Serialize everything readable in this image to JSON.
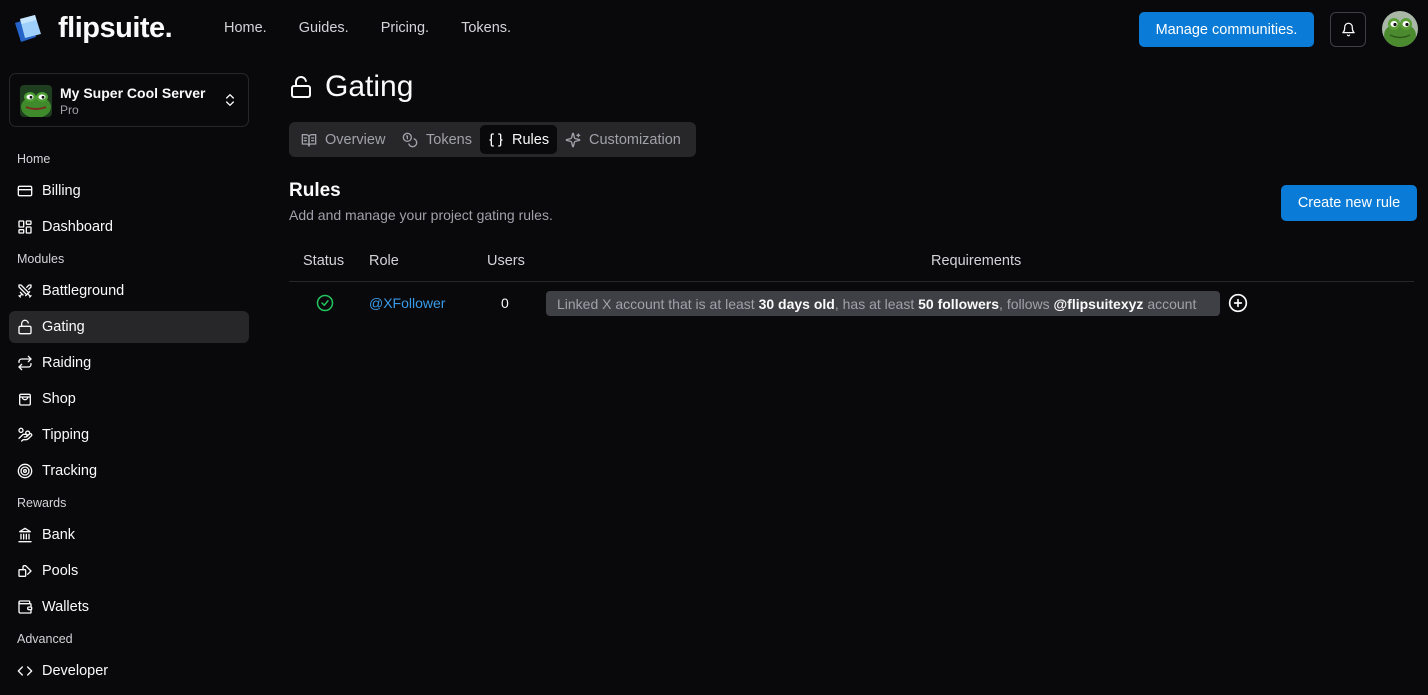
{
  "brand": {
    "name": "flipsuite."
  },
  "topnav": {
    "links": [
      "Home.",
      "Guides.",
      "Pricing.",
      "Tokens."
    ],
    "manage_label": "Manage communities."
  },
  "server": {
    "name": "My Super Cool Server",
    "plan": "Pro"
  },
  "sidebar": {
    "sections": {
      "home": "Home",
      "modules": "Modules",
      "rewards": "Rewards",
      "advanced": "Advanced"
    },
    "items": [
      {
        "label": "Billing",
        "icon": "credit-card-icon"
      },
      {
        "label": "Dashboard",
        "icon": "dashboard-icon"
      },
      {
        "label": "Battleground",
        "icon": "swords-icon"
      },
      {
        "label": "Gating",
        "icon": "unlock-icon",
        "active": true
      },
      {
        "label": "Raiding",
        "icon": "repeat-icon"
      },
      {
        "label": "Shop",
        "icon": "shopping-bag-icon"
      },
      {
        "label": "Tipping",
        "icon": "hand-coins-icon"
      },
      {
        "label": "Tracking",
        "icon": "target-icon"
      },
      {
        "label": "Bank",
        "icon": "landmark-icon"
      },
      {
        "label": "Pools",
        "icon": "coins-icon"
      },
      {
        "label": "Wallets",
        "icon": "wallet-icon"
      },
      {
        "label": "Developer",
        "icon": "code-icon"
      }
    ]
  },
  "page": {
    "title": "Gating"
  },
  "tabs": [
    {
      "label": "Overview",
      "icon": "book-open-icon"
    },
    {
      "label": "Tokens",
      "icon": "coins-icon"
    },
    {
      "label": "Rules",
      "icon": "braces-icon",
      "active": true
    },
    {
      "label": "Customization",
      "icon": "sparkles-icon"
    }
  ],
  "rules": {
    "title": "Rules",
    "subtitle": "Add and manage your project gating rules.",
    "create_label": "Create new rule",
    "columns": [
      "Status",
      "Role",
      "Users",
      "Requirements"
    ],
    "rows": [
      {
        "status": "active",
        "role": "@XFollower",
        "users": "0",
        "requirement": {
          "t1": "Linked X account that is at least",
          "b1": "30 days old",
          "t2": ", has at least",
          "b2": "50 followers",
          "t3": ", follows",
          "b3": "@flipsuitexyz",
          "t4": "account"
        }
      }
    ]
  },
  "colors": {
    "background": "#09090b",
    "accent": "#0a7bd6",
    "link": "#3b9ae8",
    "success": "#22c55e",
    "panel": "#27272a"
  }
}
